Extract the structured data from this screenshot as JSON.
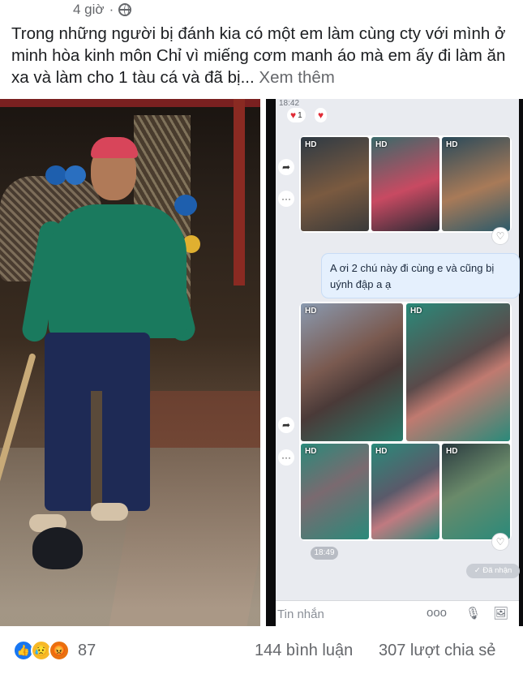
{
  "post": {
    "timestamp": "4 giờ",
    "separator": "·",
    "text": "Trong những người bị đánh kia có một em làm cùng cty với mình ở minh hòa kinh môn  Chỉ vì miếng cơm manh áo mà em ấy đi làm ăn xa và làm cho 1 tàu cá và đã bị...",
    "see_more": "Xem thêm"
  },
  "chat": {
    "top_time": "18:42",
    "reaction_count": "1",
    "group1_badges": [
      "HD",
      "HD",
      "HD"
    ],
    "message": "A ơi 2 chú này đi cùng e và cũng bị uýnh đập a ạ",
    "group2_badges": [
      "HD",
      "HD",
      "HD",
      "HD",
      "HD"
    ],
    "time_label": "18:49",
    "received_label": "Đã nhận",
    "input_placeholder": "Tin nhắn",
    "icons": [
      "forward-icon",
      "more-icon",
      "like-icon",
      "microphone-icon",
      "image-icon"
    ]
  },
  "footer": {
    "reaction_count": "87",
    "comments": "144 bình luận",
    "shares": "307 lượt chia sẻ",
    "reaction_icons": [
      "like-icon",
      "sad-icon",
      "angry-icon"
    ]
  },
  "colors": {
    "accent": "#1877f2",
    "muted_text": "#65676b",
    "bubble": "#e5f0fd"
  }
}
